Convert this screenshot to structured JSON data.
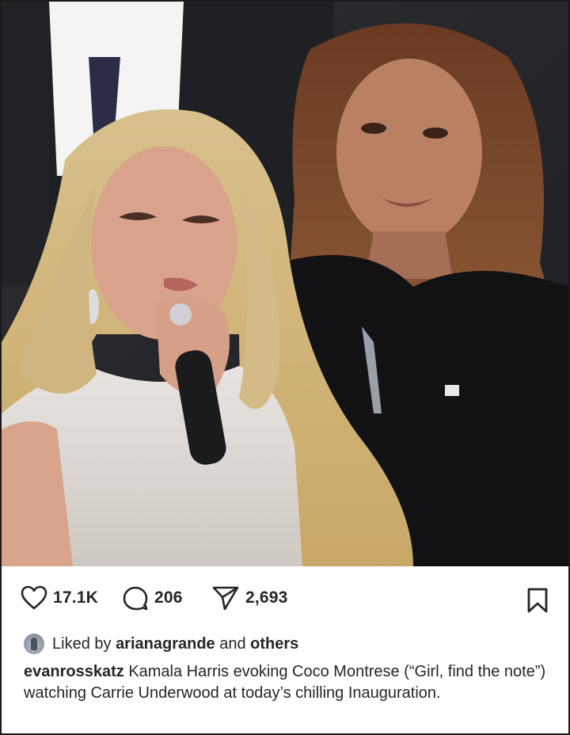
{
  "post": {
    "image_alt": "Carrie Underwood singing into a microphone with Kamala Harris standing behind her",
    "likes_count": "17.1K",
    "comments_count": "206",
    "shares_count": "2,693",
    "liked_by_prefix": "Liked by",
    "liked_by_user": "arianagrande",
    "liked_by_and": "and",
    "liked_by_others": "others",
    "author": "evanrosskatz",
    "caption_text": "Kamala Harris evoking Coco Montrese (“Girl, find the note”) watching Carrie Underwood at today’s chilling Inauguration."
  },
  "icons": {
    "like": "heart-icon",
    "comment": "comment-bubble-icon",
    "share": "paper-plane-icon",
    "save": "bookmark-icon"
  },
  "colors": {
    "text": "#262626",
    "icon_stroke": "#262626"
  }
}
